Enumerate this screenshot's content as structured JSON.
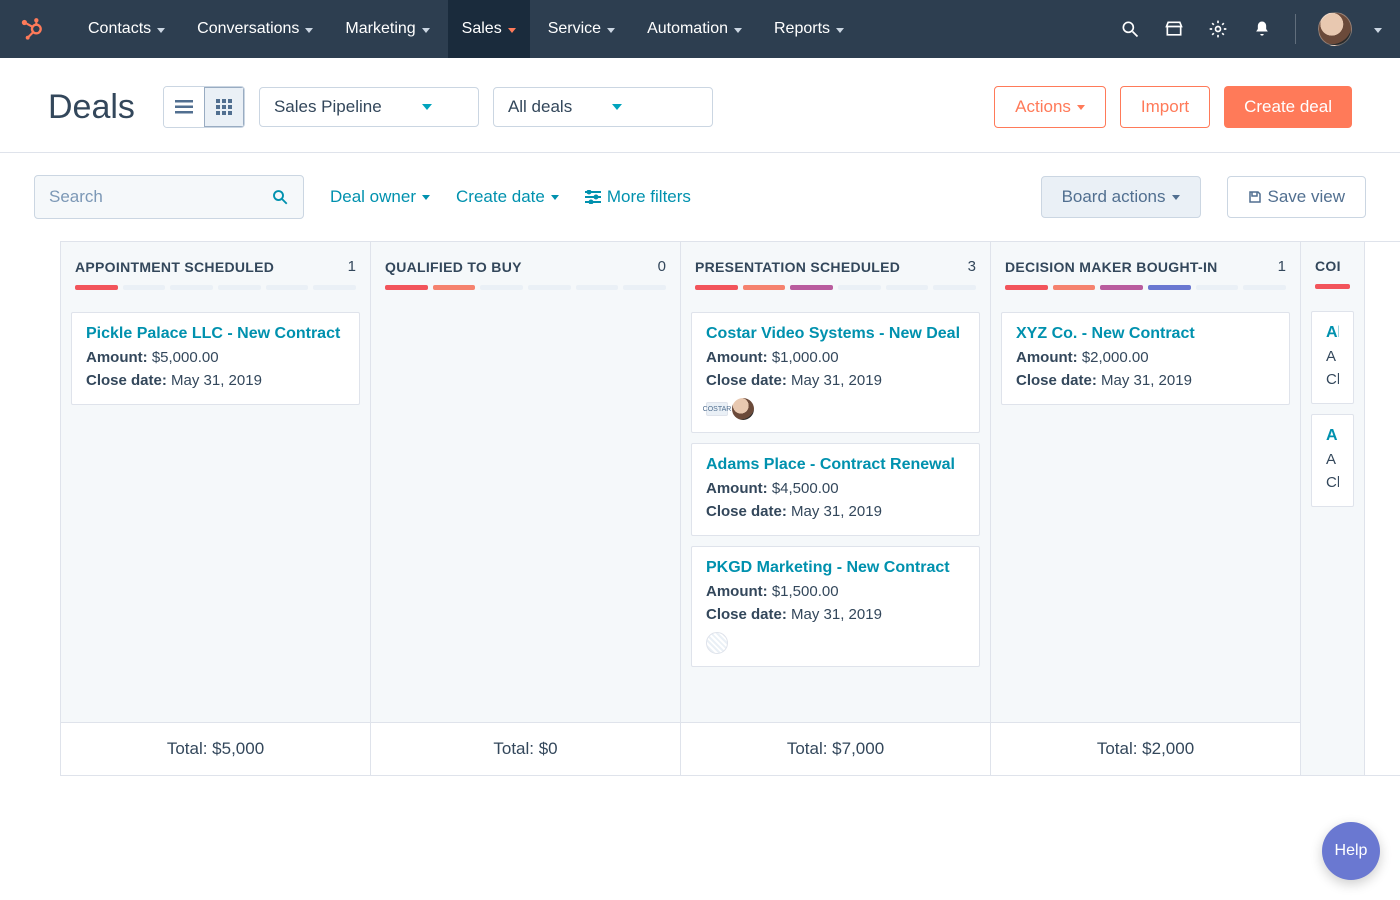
{
  "nav": {
    "items": [
      {
        "label": "Contacts"
      },
      {
        "label": "Conversations"
      },
      {
        "label": "Marketing"
      },
      {
        "label": "Sales"
      },
      {
        "label": "Service"
      },
      {
        "label": "Automation"
      },
      {
        "label": "Reports"
      }
    ]
  },
  "page": {
    "title": "Deals"
  },
  "selects": {
    "pipeline": "Sales Pipeline",
    "deal_filter": "All deals"
  },
  "header_buttons": {
    "actions": "Actions",
    "import": "Import",
    "create": "Create deal"
  },
  "filters": {
    "search_placeholder": "Search",
    "deal_owner": "Deal owner",
    "create_date": "Create date",
    "more_filters": "More filters",
    "board_actions": "Board actions",
    "save_view": "Save view"
  },
  "labels": {
    "amount": "Amount:",
    "close_date": "Close date:",
    "total_prefix": "Total: "
  },
  "columns": [
    {
      "title": "APPOINTMENT SCHEDULED",
      "count": "1",
      "segments": [
        "c1",
        "",
        "",
        "",
        "",
        ""
      ],
      "cards": [
        {
          "title": "Pickle Palace LLC - New Contract",
          "amount": "$5,000.00",
          "close": "May 31, 2019"
        }
      ],
      "total": "$5,000"
    },
    {
      "title": "QUALIFIED TO BUY",
      "count": "0",
      "segments": [
        "c1",
        "c2",
        "",
        "",
        "",
        ""
      ],
      "cards": [],
      "total": "$0"
    },
    {
      "title": "PRESENTATION SCHEDULED",
      "count": "3",
      "segments": [
        "c1",
        "c2",
        "c3",
        "",
        "",
        ""
      ],
      "cards": [
        {
          "title": "Costar Video Systems - New Deal",
          "amount": "$1,000.00",
          "close": "May 31, 2019",
          "avatars": true
        },
        {
          "title": "Adams Place - Contract Renewal",
          "amount": "$4,500.00",
          "close": "May 31, 2019"
        },
        {
          "title": "PKGD Marketing - New Contract",
          "amount": "$1,500.00",
          "close": "May 31, 2019",
          "circle": true
        }
      ],
      "total": "$7,000"
    },
    {
      "title": "DECISION MAKER BOUGHT-IN",
      "count": "1",
      "segments": [
        "c1",
        "c2",
        "c3",
        "c4",
        "",
        ""
      ],
      "cards": [
        {
          "title": "XYZ Co. - New Contract",
          "amount": "$2,000.00",
          "close": "May 31, 2019"
        }
      ],
      "total": "$2,000"
    },
    {
      "title": "COI",
      "count": "",
      "segments": [
        "c1"
      ],
      "cards": [
        {
          "title": "Al",
          "amount_label": "A",
          "close_label": "Cl"
        },
        {
          "title": "A",
          "amount_label": "A",
          "close_label": "Cl"
        }
      ],
      "total": "",
      "overflow": true
    }
  ],
  "help": "Help"
}
